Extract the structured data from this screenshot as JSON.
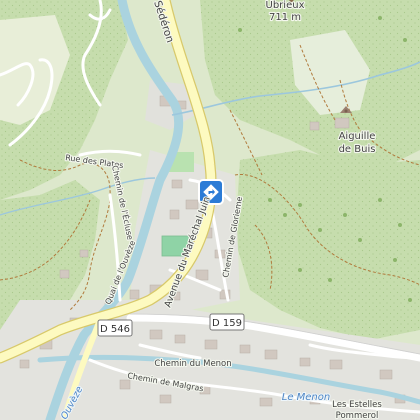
{
  "peak": {
    "name": "Ubrieux",
    "elevation": "711 m"
  },
  "rock": {
    "name_line1": "Aiguille",
    "name_line2": "de Buis"
  },
  "streets": {
    "sederon": "Sédéron",
    "rue_des_plates": "Rue des Plates",
    "chemin_ecluse": "Chemin de l'Écluse",
    "quai_ouveze": "Quai de l'Ouvèze",
    "avenue_marechal": "Avenue du Maréchal Juin",
    "chemin_glorieme": "Chemin de Glorieme",
    "chemin_menon": "Chemin du Menon",
    "chemin_malgras": "Chemin de Malgras",
    "les_estelles_line1": "Les Estelles",
    "les_estelles_line2": "Pommerol"
  },
  "road_refs": {
    "d546": "D 546",
    "d159": "D 159"
  },
  "water": {
    "menon": "Le Menon",
    "ouveze": "Ouvèze"
  },
  "marker": {
    "icon": "direction-diamond-icon",
    "color": "#2b7bd6"
  },
  "colors": {
    "forest": "#c8dfae",
    "meadow": "#dfe9cf",
    "residential": "#e2e2e2",
    "river": "#aad3df",
    "primary_road": "#fdfac0",
    "primary_casing": "#d8c96a",
    "track": "#b07a3c"
  }
}
